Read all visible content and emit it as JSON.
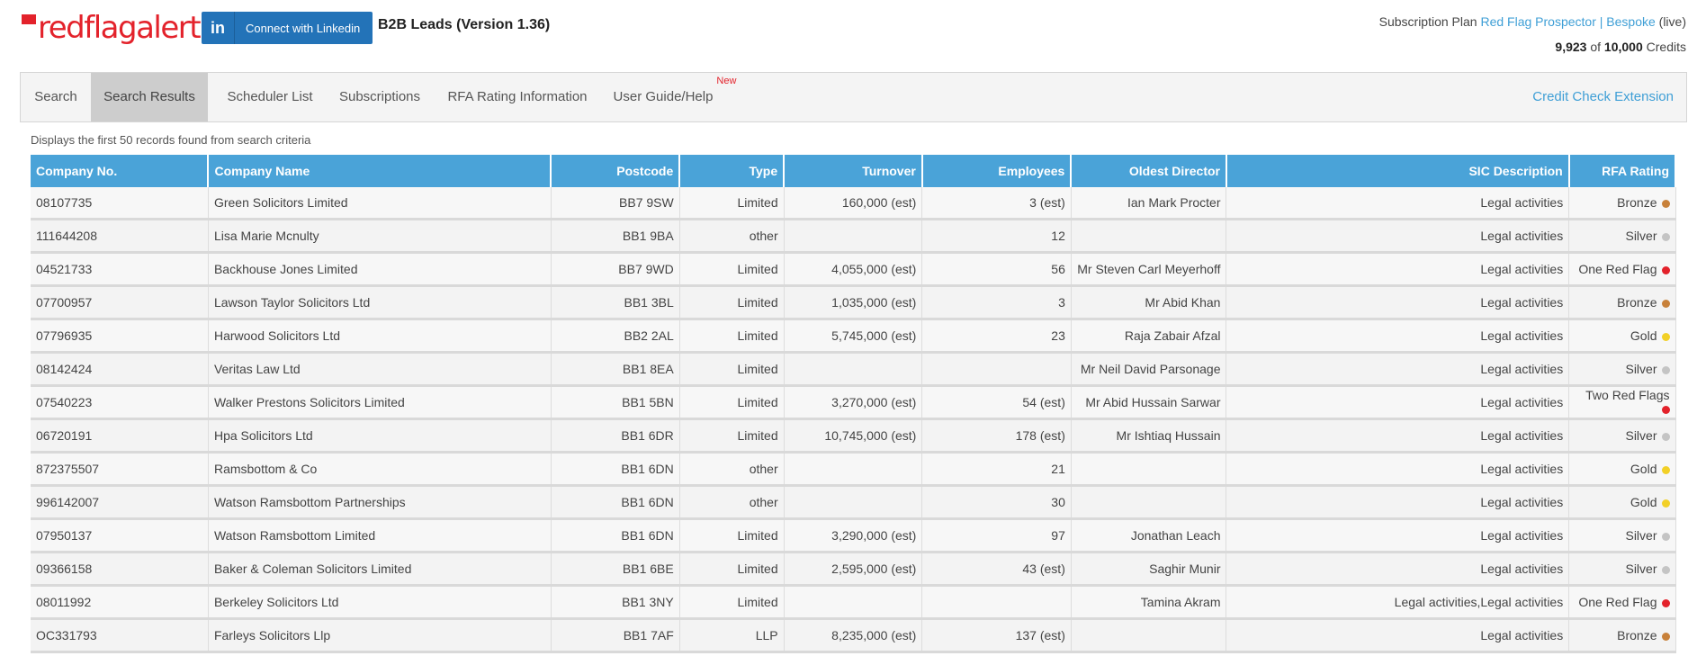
{
  "header": {
    "logo_text": "redflagalert",
    "linkedin_label": "Connect with Linkedin",
    "linkedin_icon_text": "in",
    "app_title": "B2B Leads (Version 1.36)",
    "subscription_prefix": "Subscription Plan",
    "subscription_plan": "Red Flag Prospector | Bespoke",
    "subscription_status": "(live)",
    "credits_used": "9,923",
    "credits_of": "of",
    "credits_total": "10,000",
    "credits_label": "Credits"
  },
  "nav": {
    "items": [
      {
        "label": "Search"
      },
      {
        "label": "Search Results"
      },
      {
        "label": "Scheduler List"
      },
      {
        "label": "Subscriptions"
      },
      {
        "label": "RFA Rating Information"
      },
      {
        "label": "User Guide/Help"
      }
    ],
    "new_badge": "New",
    "right_link": "Credit Check Extension"
  },
  "caption": "Displays the first 50 records found from search criteria",
  "table": {
    "headers": [
      "Company No.",
      "Company Name",
      "Postcode",
      "Type",
      "Turnover",
      "Employees",
      "Oldest Director",
      "SIC Description",
      "RFA Rating"
    ],
    "rows": [
      {
        "no": "08107735",
        "name": "Green Solicitors Limited",
        "postcode": "BB7 9SW",
        "type": "Limited",
        "turnover": "160,000 (est)",
        "employees": "3 (est)",
        "director": "Ian Mark Procter",
        "sic": "Legal activities",
        "rating": "Bronze",
        "color": "#c8813a"
      },
      {
        "no": "111644208",
        "name": "Lisa Marie Mcnulty",
        "postcode": "BB1 9BA",
        "type": "other",
        "turnover": "",
        "employees": "12",
        "director": "",
        "sic": "Legal activities",
        "rating": "Silver",
        "color": "#c4c4c4"
      },
      {
        "no": "04521733",
        "name": "Backhouse Jones Limited",
        "postcode": "BB7 9WD",
        "type": "Limited",
        "turnover": "4,055,000 (est)",
        "employees": "56",
        "director": "Mr Steven Carl Meyerhoff",
        "sic": "Legal activities",
        "rating": "One Red Flag",
        "color": "#e3222b"
      },
      {
        "no": "07700957",
        "name": "Lawson Taylor Solicitors Ltd",
        "postcode": "BB1 3BL",
        "type": "Limited",
        "turnover": "1,035,000 (est)",
        "employees": "3",
        "director": "Mr Abid Khan",
        "sic": "Legal activities",
        "rating": "Bronze",
        "color": "#c8813a"
      },
      {
        "no": "07796935",
        "name": "Harwood Solicitors Ltd",
        "postcode": "BB2 2AL",
        "type": "Limited",
        "turnover": "5,745,000 (est)",
        "employees": "23",
        "director": "Raja Zabair Afzal",
        "sic": "Legal activities",
        "rating": "Gold",
        "color": "#f2d027"
      },
      {
        "no": "08142424",
        "name": "Veritas Law Ltd",
        "postcode": "BB1 8EA",
        "type": "Limited",
        "turnover": "",
        "employees": "",
        "director": "Mr Neil David Parsonage",
        "sic": "Legal activities",
        "rating": "Silver",
        "color": "#c4c4c4"
      },
      {
        "no": "07540223",
        "name": "Walker Prestons Solicitors Limited",
        "postcode": "BB1 5BN",
        "type": "Limited",
        "turnover": "3,270,000 (est)",
        "employees": "54 (est)",
        "director": "Mr Abid Hussain Sarwar",
        "sic": "Legal activities",
        "rating": "Two Red Flags",
        "color": "#e3222b"
      },
      {
        "no": "06720191",
        "name": "Hpa Solicitors Ltd",
        "postcode": "BB1 6DR",
        "type": "Limited",
        "turnover": "10,745,000 (est)",
        "employees": "178 (est)",
        "director": "Mr Ishtiaq Hussain",
        "sic": "Legal activities",
        "rating": "Silver",
        "color": "#c4c4c4"
      },
      {
        "no": "872375507",
        "name": "Ramsbottom & Co",
        "postcode": "BB1 6DN",
        "type": "other",
        "turnover": "",
        "employees": "21",
        "director": "",
        "sic": "Legal activities",
        "rating": "Gold",
        "color": "#f2d027"
      },
      {
        "no": "996142007",
        "name": "Watson Ramsbottom Partnerships",
        "postcode": "BB1 6DN",
        "type": "other",
        "turnover": "",
        "employees": "30",
        "director": "",
        "sic": "Legal activities",
        "rating": "Gold",
        "color": "#f2d027"
      },
      {
        "no": "07950137",
        "name": "Watson Ramsbottom Limited",
        "postcode": "BB1 6DN",
        "type": "Limited",
        "turnover": "3,290,000 (est)",
        "employees": "97",
        "director": "Jonathan Leach",
        "sic": "Legal activities",
        "rating": "Silver",
        "color": "#c4c4c4"
      },
      {
        "no": "09366158",
        "name": "Baker & Coleman Solicitors Limited",
        "postcode": "BB1 6BE",
        "type": "Limited",
        "turnover": "2,595,000 (est)",
        "employees": "43 (est)",
        "director": "Saghir Munir",
        "sic": "Legal activities",
        "rating": "Silver",
        "color": "#c4c4c4"
      },
      {
        "no": "08011992",
        "name": "Berkeley Solicitors Ltd",
        "postcode": "BB1 3NY",
        "type": "Limited",
        "turnover": "",
        "employees": "",
        "director": "Tamina Akram",
        "sic": "Legal activities,Legal activities",
        "rating": "One Red Flag",
        "color": "#e3222b"
      },
      {
        "no": "OC331793",
        "name": "Farleys Solicitors Llp",
        "postcode": "BB1 7AF",
        "type": "LLP",
        "turnover": "8,235,000 (est)",
        "employees": "137 (est)",
        "director": "",
        "sic": "Legal activities",
        "rating": "Bronze",
        "color": "#c8813a"
      }
    ]
  }
}
